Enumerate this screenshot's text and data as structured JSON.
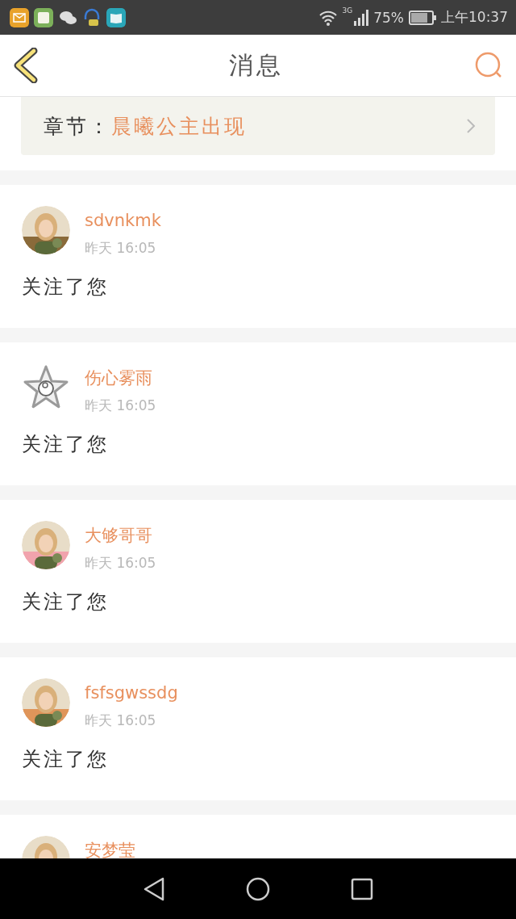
{
  "status_bar": {
    "network": "3G",
    "battery": "75%",
    "time": "上午10:37"
  },
  "header": {
    "title": "消息"
  },
  "chapter": {
    "label": "章节：",
    "value": "晨曦公主出现"
  },
  "notices": [
    {
      "name": "sdvnkmk",
      "time": "昨天 16:05",
      "text": "关注了您"
    },
    {
      "avatar": {
        "kind": "star"
      },
      "name": "伤心雾雨",
      "time": "昨天 16:05",
      "text": "关注了您"
    },
    {
      "name": "大够哥哥",
      "time": "昨天 16:05",
      "text": "关注了您"
    },
    {
      "name": "fsfsgwssdg",
      "time": "昨天 16:05",
      "text": "关注了您"
    },
    {
      "name": "安梦莹"
    }
  ]
}
